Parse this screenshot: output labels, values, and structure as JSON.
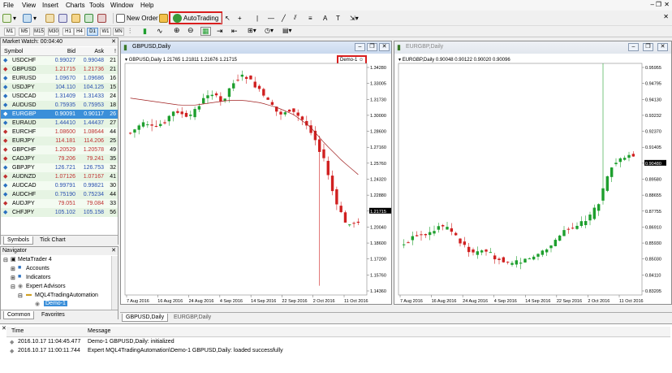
{
  "menu": [
    "File",
    "View",
    "Insert",
    "Charts",
    "Tools",
    "Window",
    "Help"
  ],
  "toolbar": {
    "new_order": "New Order",
    "autotrading": "AutoTrading"
  },
  "timeframes": [
    "M1",
    "M5",
    "M15",
    "M30",
    "H1",
    "H4",
    "D1",
    "W1",
    "MN"
  ],
  "market_watch": {
    "title": "Market Watch: 00:04:40",
    "headers": {
      "symbol": "Symbol",
      "bid": "Bid",
      "ask": "Ask",
      "spread": "!"
    },
    "rows": [
      {
        "symbol": "USDCHF",
        "bid": "0.99027",
        "ask": "0.99048",
        "spread": "21"
      },
      {
        "symbol": "GBPUSD",
        "bid": "1.21715",
        "ask": "1.21736",
        "spread": "21"
      },
      {
        "symbol": "EURUSD",
        "bid": "1.09670",
        "ask": "1.09686",
        "spread": "16"
      },
      {
        "symbol": "USDJPY",
        "bid": "104.110",
        "ask": "104.125",
        "spread": "15"
      },
      {
        "symbol": "USDCAD",
        "bid": "1.31409",
        "ask": "1.31433",
        "spread": "24"
      },
      {
        "symbol": "AUDUSD",
        "bid": "0.75935",
        "ask": "0.75953",
        "spread": "18"
      },
      {
        "symbol": "EURGBP",
        "bid": "0.90091",
        "ask": "0.90117",
        "spread": "26"
      },
      {
        "symbol": "EURAUD",
        "bid": "1.44410",
        "ask": "1.44437",
        "spread": "27"
      },
      {
        "symbol": "EURCHF",
        "bid": "1.08600",
        "ask": "1.08644",
        "spread": "44"
      },
      {
        "symbol": "EURJPY",
        "bid": "114.181",
        "ask": "114.206",
        "spread": "25"
      },
      {
        "symbol": "GBPCHF",
        "bid": "1.20529",
        "ask": "1.20578",
        "spread": "49"
      },
      {
        "symbol": "CADJPY",
        "bid": "79.206",
        "ask": "79.241",
        "spread": "35"
      },
      {
        "symbol": "GBPJPY",
        "bid": "126.721",
        "ask": "126.753",
        "spread": "32"
      },
      {
        "symbol": "AUDNZD",
        "bid": "1.07126",
        "ask": "1.07167",
        "spread": "41"
      },
      {
        "symbol": "AUDCAD",
        "bid": "0.99791",
        "ask": "0.99821",
        "spread": "30"
      },
      {
        "symbol": "AUDCHF",
        "bid": "0.75190",
        "ask": "0.75234",
        "spread": "44"
      },
      {
        "symbol": "AUDJPY",
        "bid": "79.051",
        "ask": "79.084",
        "spread": "33"
      },
      {
        "symbol": "CHFJPY",
        "bid": "105.102",
        "ask": "105.158",
        "spread": "56"
      }
    ],
    "tabs": [
      "Symbols",
      "Tick Chart"
    ]
  },
  "navigator": {
    "title": "Navigator",
    "items": [
      "MetaTrader 4",
      "Accounts",
      "Indicators",
      "Expert Advisors",
      "MQL4TradingAutomation",
      "Demo-1"
    ],
    "tabs": [
      "Common",
      "Favorites"
    ]
  },
  "chart1": {
    "title": "GBPUSD,Daily",
    "info": "GBPUSD,Daily  1.21765 1.21811 1.21676 1.21715",
    "ea_label": "Demo-1",
    "current_price": "1.21715",
    "price_labels": [
      "1.34280",
      "1.33005",
      "1.31730",
      "1.30000",
      "1.28600",
      "1.27160",
      "1.25760",
      "1.24320",
      "1.22880",
      "1.21715",
      "1.20040",
      "1.18600",
      "1.17200",
      "1.15760",
      "1.14360"
    ],
    "date_labels": [
      "7 Aug 2016",
      "16 Aug 2016",
      "24 Aug 2016",
      "4 Sep 2016",
      "14 Sep 2016",
      "22 Sep 2016",
      "2 Oct 2016",
      "11 Oct 2016"
    ]
  },
  "chart2": {
    "title": "EURGBP,Daily",
    "info": "EURGBP,Daily  0.90048 0.90122 0.90020 0.90096",
    "current_price": "0.90096",
    "price_labels": [
      "0.95955",
      "0.94795",
      "0.94130",
      "0.93232",
      "0.92370",
      "0.91405",
      "0.90480",
      "0.89580",
      "0.88655",
      "0.87755",
      "0.86910",
      "0.85930",
      "0.85030",
      "0.84110",
      "0.83205"
    ],
    "date_labels": [
      "7 Aug 2016",
      "16 Aug 2016",
      "24 Aug 2016",
      "4 Sep 2016",
      "14 Sep 2016",
      "22 Sep 2016",
      "2 Oct 2016",
      "11 Oct 2016"
    ]
  },
  "chart_tabs": [
    "GBPUSD,Daily",
    "EURGBP,Daily"
  ],
  "terminal": {
    "headers": {
      "time": "Time",
      "message": "Message"
    },
    "rows": [
      {
        "time": "2016.10.17 11:04:45.477",
        "message": "Demo-1 GBPUSD,Daily: initialized"
      },
      {
        "time": "2016.10.17 11:00:11.744",
        "message": "Expert MQL4TradingAutomation\\Demo-1 GBPUSD,Daily: loaded successfully"
      }
    ]
  },
  "colors": {
    "bull": "#1e9f2e",
    "bear": "#d02020",
    "ma": "#a02020",
    "highlight": "#d91e1e",
    "selected": "#3b8fd9"
  }
}
